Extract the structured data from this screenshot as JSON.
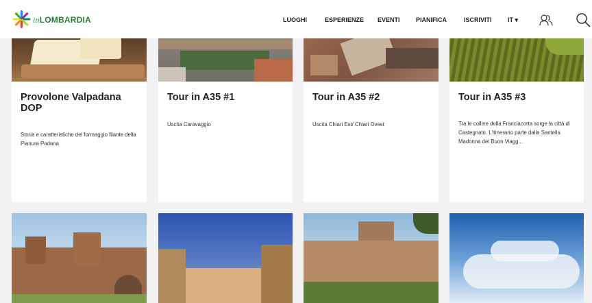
{
  "header": {
    "logo": {
      "prefix": "in",
      "name": "LOMBARDIA"
    },
    "nav": [
      {
        "label": "LUOGHI"
      },
      {
        "label": "ESPERIENZE"
      },
      {
        "label": "EVENTI"
      },
      {
        "label": "PIANIFICA"
      },
      {
        "label": "ISCRIVITI"
      },
      {
        "label": "IT ▾"
      }
    ],
    "icons": [
      "users-icon",
      "search-icon"
    ]
  },
  "cards": [
    {
      "title": "Provolone Valpadana DOP",
      "description": "Storia e caratteristiche del formaggio filante della Pianura Padana"
    },
    {
      "title": "Tour in A35 #1",
      "description": "Uscita Caravaggio"
    },
    {
      "title": "Tour in A35 #2",
      "description": "Uscita Chiari Est/ Chiari Ovest"
    },
    {
      "title": "Tour in A35 #3",
      "description": "Tra le colline della Franciacorta sorge la città di Castegnato. L'itinerario parte dalla Santella Madonna del Buon Viagg..."
    }
  ],
  "colors": {
    "brand_green": "#2f7d3a",
    "page_bg": "#f2f2f2"
  }
}
